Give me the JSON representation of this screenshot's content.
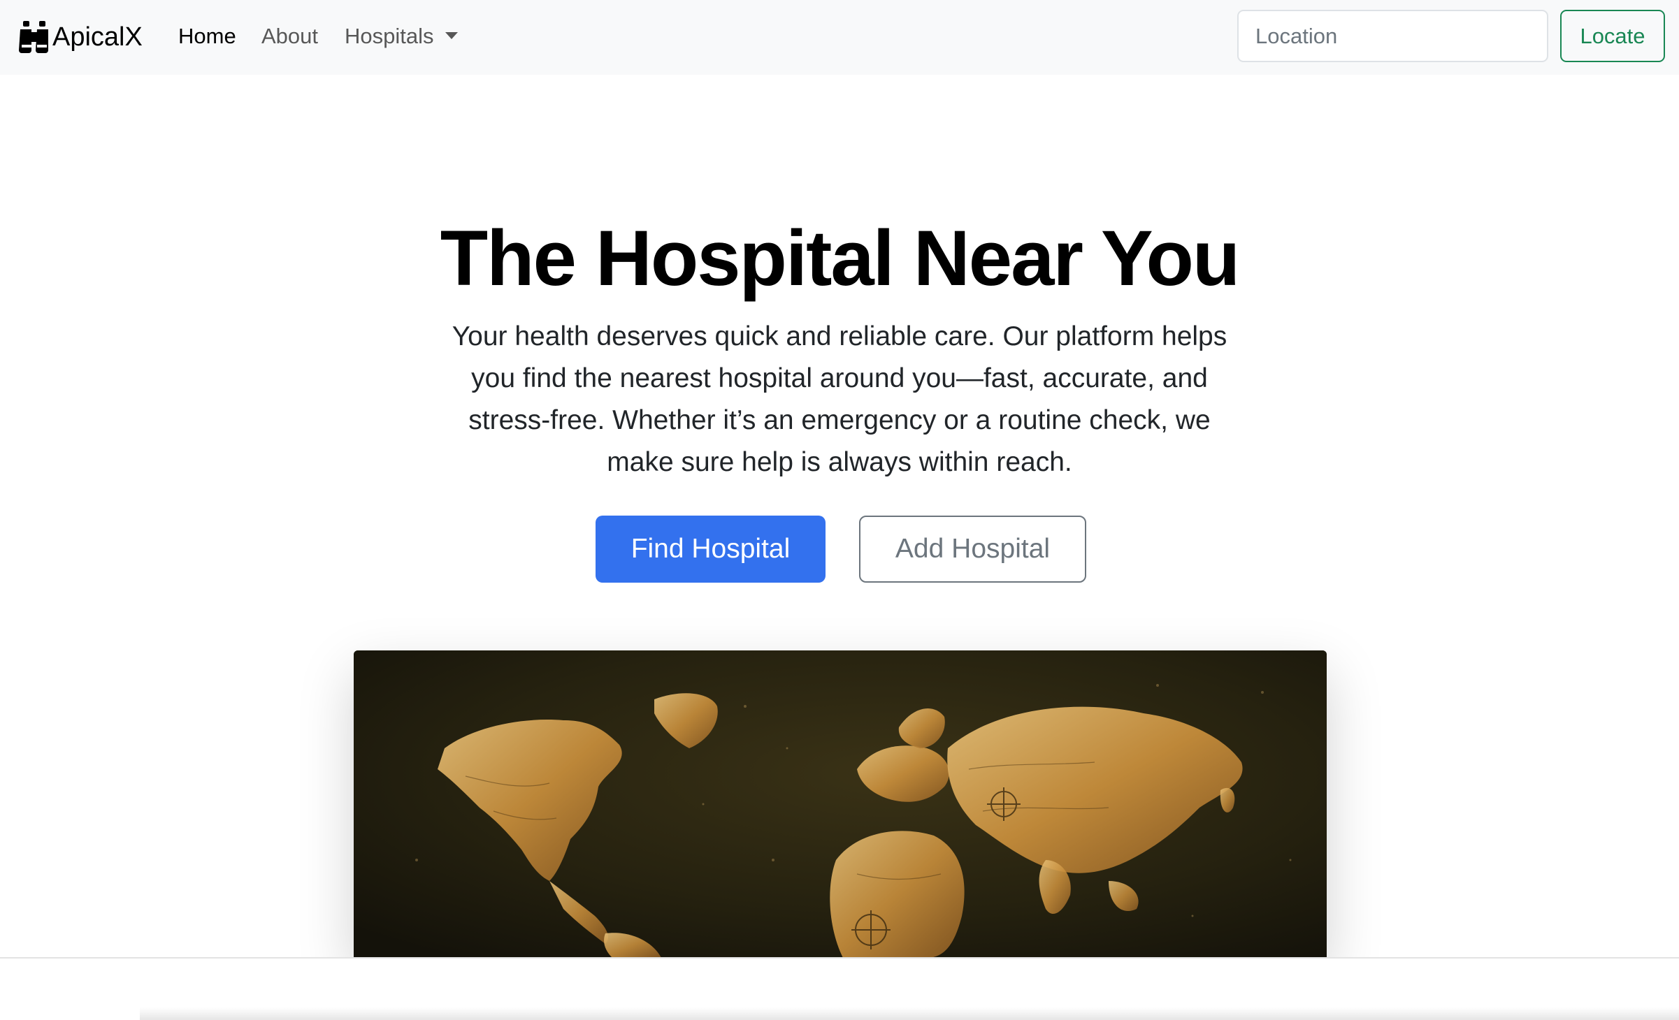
{
  "brand": {
    "name": "ApicalX",
    "icon": "binoculars-icon"
  },
  "nav": {
    "home": "Home",
    "about": "About",
    "hospitals": "Hospitals"
  },
  "search": {
    "placeholder": "Location",
    "value": "",
    "button": "Locate"
  },
  "hero": {
    "title": "The Hospital Near You",
    "lead": "Your health deserves quick and reliable care. Our platform helps you find the nearest hospital around you—fast, accurate, and stress-free. Whether it’s an emergency or a routine check, we make sure help is always within reach.",
    "primary_button": "Find Hospital",
    "secondary_button": "Add Hospital"
  },
  "colors": {
    "primary": "#3371ee",
    "success": "#198754",
    "secondary": "#6c757d",
    "navbar_bg": "#f8f9fa"
  },
  "hero_image": {
    "subject": "world-map-image"
  }
}
